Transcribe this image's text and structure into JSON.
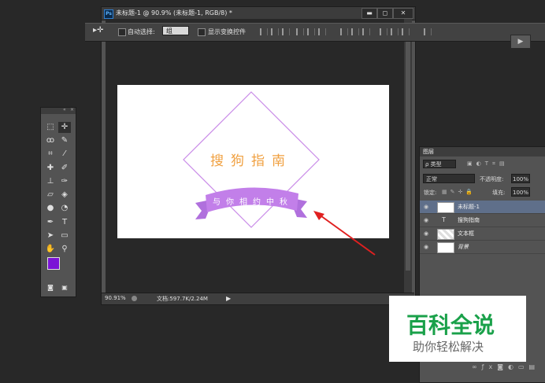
{
  "document": {
    "title": "未标题-1 @ 90.9% (未标题-1, RGB/8) *",
    "zoom": "90.91%",
    "doc_info": "文档:597.7K/2.24M",
    "window_buttons": [
      "▬",
      "◻",
      "✕"
    ]
  },
  "options_bar": {
    "auto_select_label": "自动选择:",
    "auto_select_value": "组",
    "show_transform_label": "显示变换控件"
  },
  "artwork": {
    "main_text": "搜狗指南",
    "ribbon_text": "与你相约中秋",
    "diamond_color": "#c98be8",
    "text_color": "#f0a040",
    "ribbon_color": "#c27fe9",
    "arrow_color": "#e02020"
  },
  "tools": {
    "foreground_color": "#7b13d6",
    "background_color": "#ffffff"
  },
  "layers": {
    "tab_label": "图层",
    "filter_label": "ρ 类型",
    "blend_mode": "正常",
    "opacity_label": "不透明度:",
    "opacity_value": "100%",
    "lock_label": "锁定:",
    "fill_label": "填充:",
    "fill_value": "100%",
    "items": [
      {
        "name": "未标题-1",
        "type": "smart"
      },
      {
        "name": "搜狗指南",
        "type": "text"
      },
      {
        "name": "文本框",
        "type": "raster"
      },
      {
        "name": "背景",
        "type": "background"
      }
    ]
  },
  "watermark": {
    "title": "百科全说",
    "subtitle": "助你轻松解决",
    "title_color": "#1aa14a"
  }
}
